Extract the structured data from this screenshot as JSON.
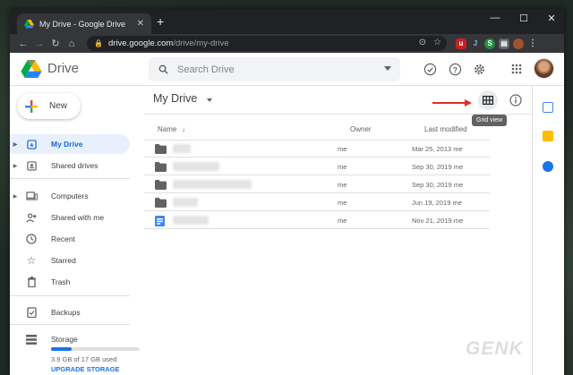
{
  "browser": {
    "tab_title": "My Drive - Google Drive",
    "url_host": "drive.google.com",
    "url_path": "/drive/my-drive",
    "tab_close": "✕",
    "new_tab": "+",
    "window_controls": [
      "—",
      "☐",
      "✕"
    ]
  },
  "header": {
    "product_name": "Drive",
    "search_placeholder": "Search Drive",
    "icons": [
      "offline-status-icon",
      "help-icon",
      "settings-icon",
      "apps-grid-icon"
    ]
  },
  "sidebar": {
    "new_label": "New",
    "items": [
      {
        "label": "My Drive",
        "icon": "my-drive-icon",
        "expandable": true,
        "active": true
      },
      {
        "label": "Shared drives",
        "icon": "shared-drives-icon",
        "expandable": true
      },
      {
        "label": "Computers",
        "icon": "computers-icon",
        "expandable": true
      },
      {
        "label": "Shared with me",
        "icon": "shared-with-me-icon"
      },
      {
        "label": "Recent",
        "icon": "clock-icon"
      },
      {
        "label": "Starred",
        "icon": "star-icon"
      },
      {
        "label": "Trash",
        "icon": "trash-icon"
      },
      {
        "label": "Backups",
        "icon": "backups-icon"
      },
      {
        "label": "Storage",
        "icon": "storage-icon"
      }
    ],
    "storage_used_fraction": 0.23,
    "storage_text": "3.9 GB of 17 GB used",
    "upgrade_label": "UPGRADE STORAGE"
  },
  "main": {
    "title": "My Drive",
    "tooltip": "Grid view",
    "columns": {
      "name": "Name",
      "owner": "Owner",
      "modified": "Last modified"
    },
    "sort_arrow": "↓",
    "rows": [
      {
        "type": "folder",
        "owner": "me",
        "modified": "Mar 25, 2013 me"
      },
      {
        "type": "folder",
        "owner": "me",
        "modified": "Sep 30, 2019 me"
      },
      {
        "type": "folder",
        "owner": "me",
        "modified": "Sep 30, 2019 me"
      },
      {
        "type": "folder",
        "owner": "me",
        "modified": "Jun 19, 2019 me"
      },
      {
        "type": "form",
        "owner": "me",
        "modified": "Nov 21, 2019 me"
      }
    ]
  },
  "colors": {
    "accent_blue": "#1a73e8",
    "active_bg": "#e8f0fe",
    "arrow_red": "#d93025"
  },
  "watermark": "GENK"
}
